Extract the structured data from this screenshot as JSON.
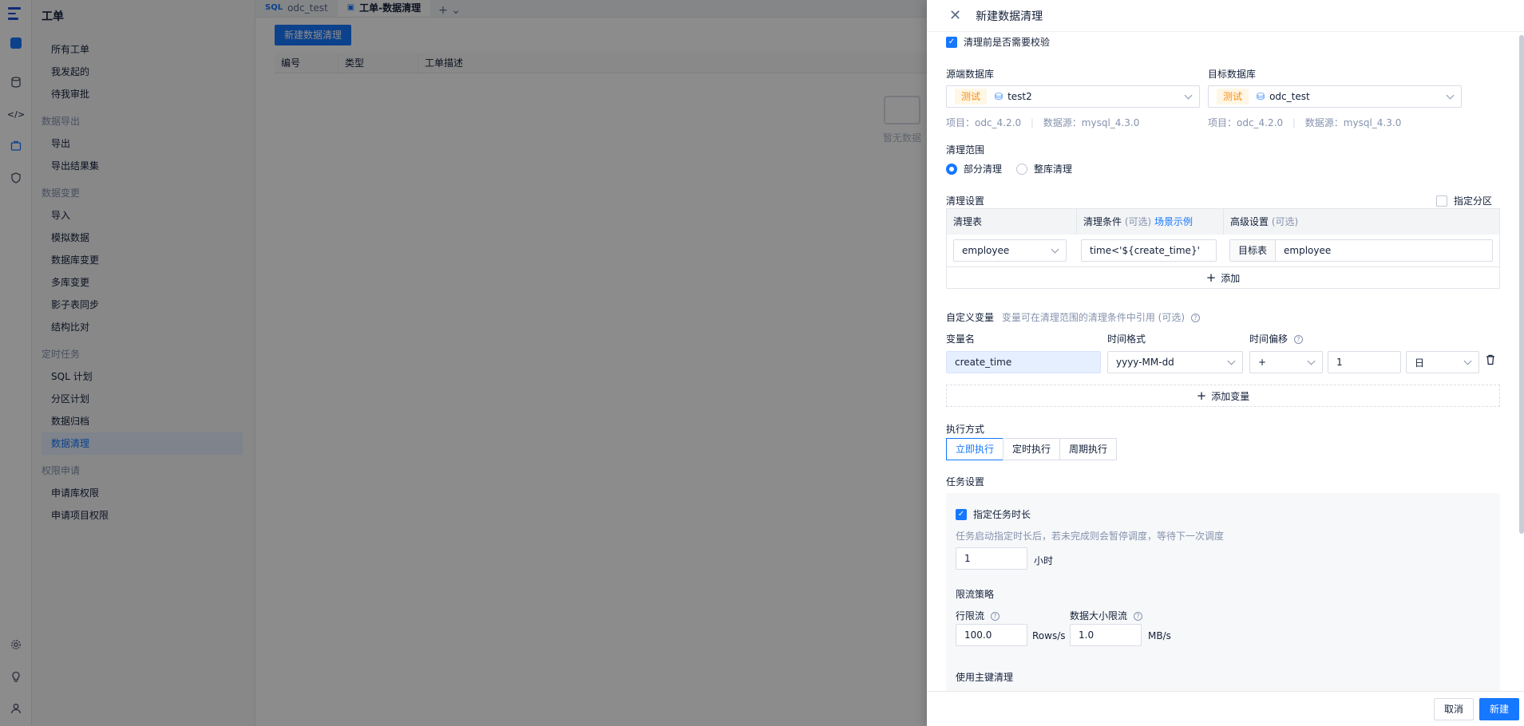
{
  "rail": {
    "icons": [
      "logo-icon",
      "database-icon",
      "code-icon",
      "ticket-icon",
      "shield-icon",
      "settings-icon",
      "bulb-icon",
      "user-icon"
    ]
  },
  "menu": {
    "title": "工单",
    "items": [
      {
        "type": "item",
        "label": "所有工单"
      },
      {
        "type": "item",
        "label": "我发起的"
      },
      {
        "type": "item",
        "label": "待我审批"
      },
      {
        "type": "group",
        "label": "数据导出"
      },
      {
        "type": "item",
        "label": "导出"
      },
      {
        "type": "item",
        "label": "导出结果集"
      },
      {
        "type": "group",
        "label": "数据变更"
      },
      {
        "type": "item",
        "label": "导入"
      },
      {
        "type": "item",
        "label": "模拟数据"
      },
      {
        "type": "item",
        "label": "数据库变更"
      },
      {
        "type": "item",
        "label": "多库变更"
      },
      {
        "type": "item",
        "label": "影子表同步"
      },
      {
        "type": "item",
        "label": "结构比对"
      },
      {
        "type": "group",
        "label": "定时任务"
      },
      {
        "type": "item",
        "label": "SQL 计划"
      },
      {
        "type": "item",
        "label": "分区计划"
      },
      {
        "type": "item",
        "label": "数据归档"
      },
      {
        "type": "item",
        "label": "数据清理",
        "active": true
      },
      {
        "type": "group",
        "label": "权限申请"
      },
      {
        "type": "item",
        "label": "申请库权限"
      },
      {
        "type": "item",
        "label": "申请项目权限"
      }
    ]
  },
  "tabs": [
    {
      "icon": "SQL",
      "label": "odc_test",
      "active": false
    },
    {
      "icon": "▣",
      "label": "工单-数据清理",
      "active": true
    }
  ],
  "main": {
    "new_button": "新建数据清理",
    "columns": [
      "编号",
      "类型",
      "工单描述"
    ],
    "empty_text": "暂无数据"
  },
  "drawer": {
    "title": "新建数据清理",
    "verify_label": "清理前是否需要校验",
    "source": {
      "label": "源端数据库",
      "tag": "测试",
      "db": "test2",
      "project": "项目：odc_4.2.0",
      "datasource": "数据源：mysql_4.3.0"
    },
    "target": {
      "label": "目标数据库",
      "tag": "测试",
      "db": "odc_test",
      "project": "项目：odc_4.2.0",
      "datasource": "数据源：mysql_4.3.0"
    },
    "scope": {
      "label": "清理范围",
      "opt_partial": "部分清理",
      "opt_full": "整库清理"
    },
    "settings": {
      "label": "清理设置",
      "partition_label": "指定分区",
      "col_table": "清理表",
      "col_cond": "清理条件",
      "optional": "(可选)",
      "example": "场景示例",
      "col_adv": "高级设置",
      "table_value": "employee",
      "cond_value": "time<'${create_time}'",
      "target_prefix": "目标表",
      "target_value": "employee",
      "add_label": "添加"
    },
    "vars": {
      "label": "自定义变量",
      "hint": "变量可在清理范围的清理条件中引用 (可选)",
      "col_name": "变量名",
      "col_format": "时间格式",
      "col_offset": "时间偏移",
      "name_value": "create_time",
      "format_value": "yyyy-MM-dd",
      "op_value": "+",
      "num_value": "1",
      "unit_value": "日",
      "add_label": "添加变量"
    },
    "exec": {
      "label": "执行方式",
      "options": [
        "立即执行",
        "定时执行",
        "周期执行"
      ]
    },
    "task": {
      "label": "任务设置",
      "duration_label": "指定任务时长",
      "duration_hint": "任务启动指定时长后，若未完成则会暂停调度，等待下一次调度",
      "duration_value": "1",
      "duration_unit": "小时",
      "limit_label": "限流策略",
      "row_limit_label": "行限流",
      "row_limit_value": "100.0",
      "row_limit_unit": "Rows/s",
      "size_limit_label": "数据大小限流",
      "size_limit_value": "1.0",
      "size_limit_unit": "MB/s",
      "pk_label": "使用主键清理"
    },
    "footer": {
      "cancel": "取消",
      "submit": "新建"
    }
  }
}
